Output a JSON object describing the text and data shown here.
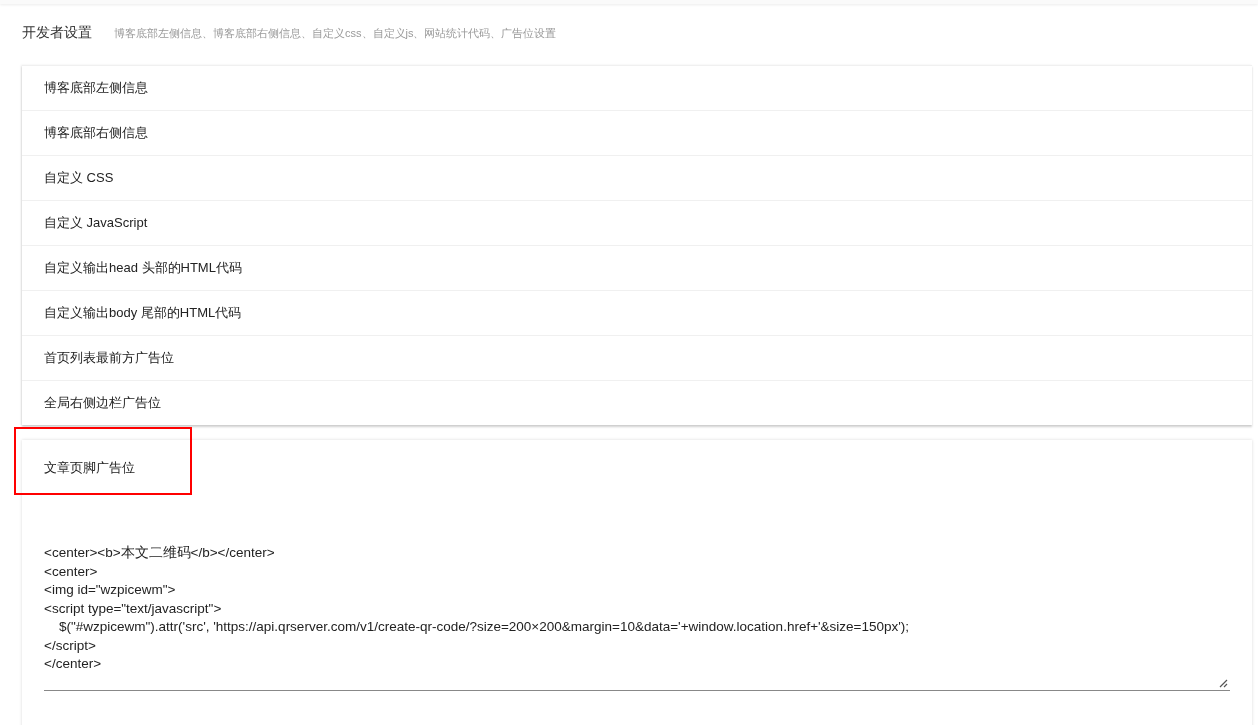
{
  "header": {
    "title": "开发者设置",
    "subtitle": "博客底部左侧信息、博客底部右侧信息、自定义css、自定义js、网站统计代码、广告位设置"
  },
  "panels": [
    {
      "title": "博客底部左侧信息",
      "expanded": false,
      "highlighted": false
    },
    {
      "title": "博客底部右侧信息",
      "expanded": false,
      "highlighted": false
    },
    {
      "title": "自定义 CSS",
      "expanded": false,
      "highlighted": false
    },
    {
      "title": "自定义 JavaScript",
      "expanded": false,
      "highlighted": false
    },
    {
      "title": "自定义输出head 头部的HTML代码",
      "expanded": false,
      "highlighted": false
    },
    {
      "title": "自定义输出body 尾部的HTML代码",
      "expanded": false,
      "highlighted": false
    },
    {
      "title": "首页列表最前方广告位",
      "expanded": false,
      "highlighted": false
    },
    {
      "title": "全局右侧边栏广告位",
      "expanded": false,
      "highlighted": false
    },
    {
      "title": "文章页脚广告位",
      "expanded": true,
      "highlighted": true,
      "value": "<center><b>本文二维码</b></center>\n<center>\n<img id=\"wzpicewm\">\n<script type=\"text/javascript\">\n    $(\"#wzpicewm\").attr('src', 'https://api.qrserver.com/v1/create-qr-code/?size=200×200&margin=10&data='+window.location.href+'&size=150px');\n</script>\n</center>"
    }
  ]
}
